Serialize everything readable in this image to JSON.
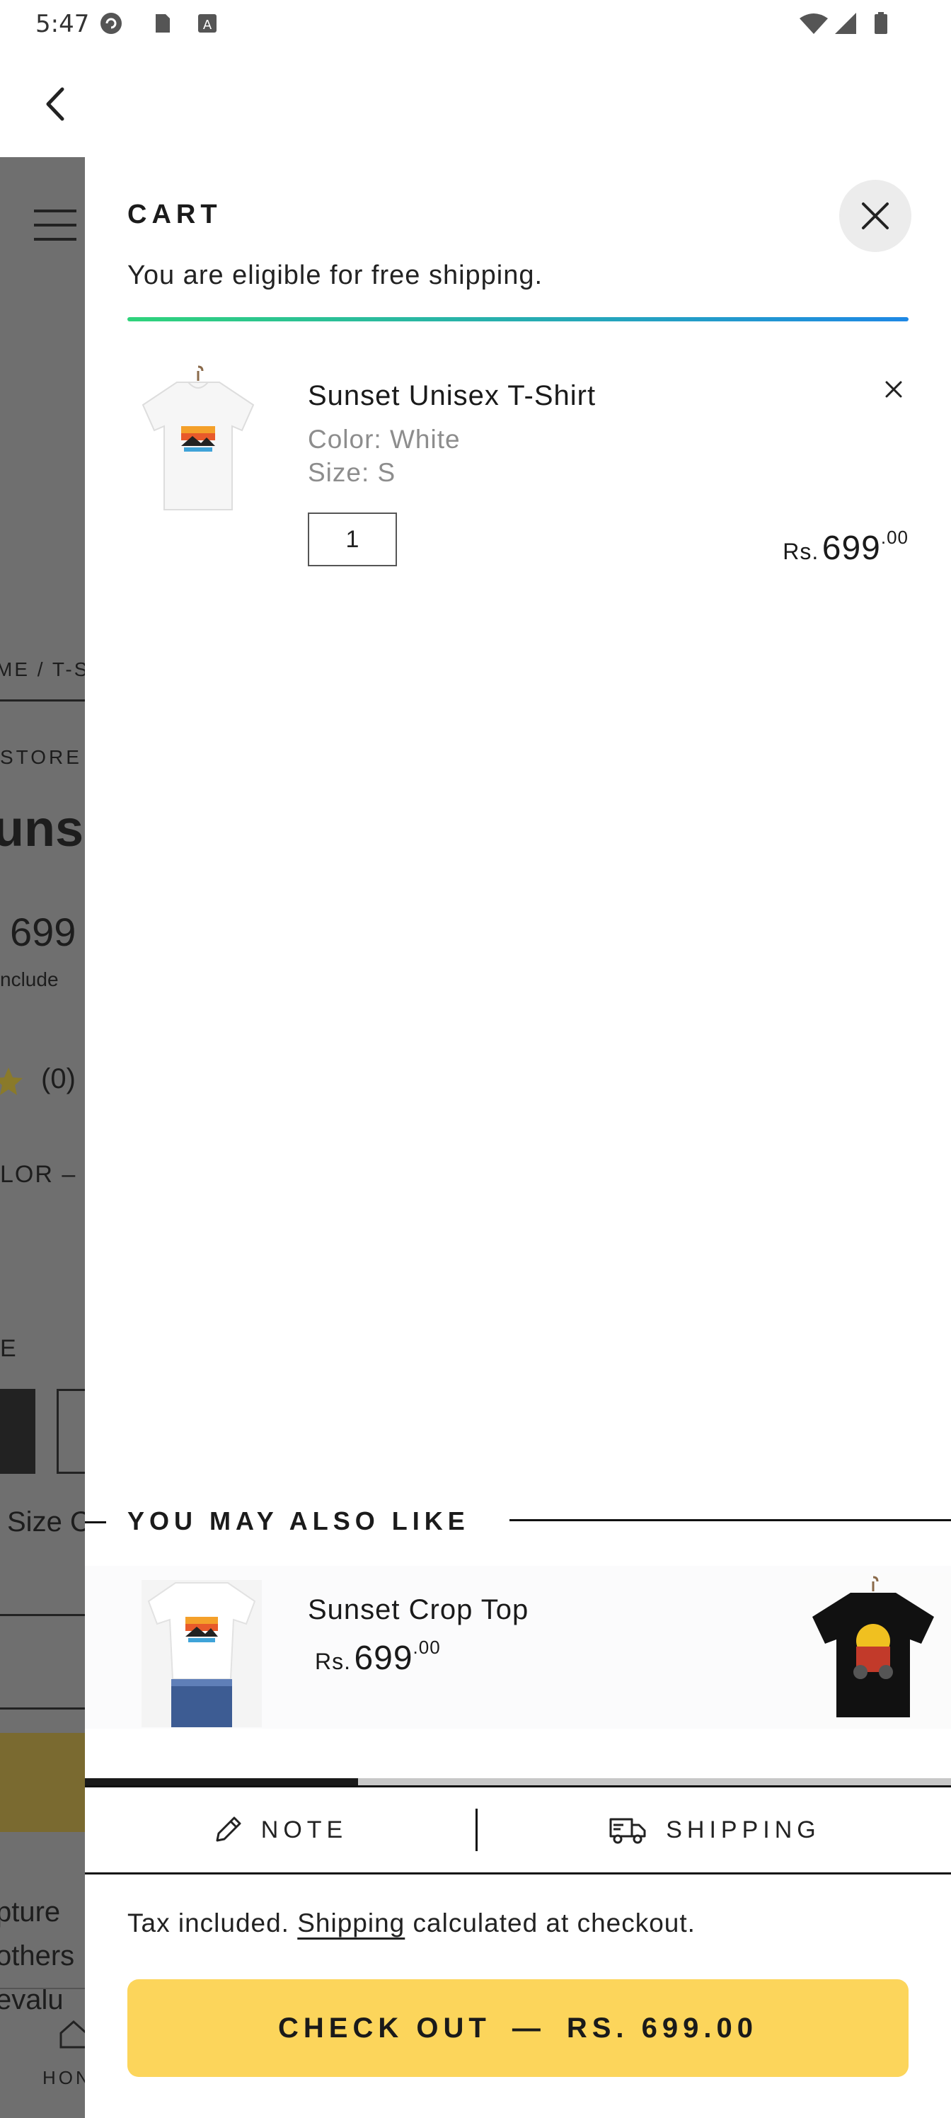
{
  "status_bar": {
    "time": "5:47"
  },
  "background_page": {
    "breadcrumb_fragment": "ME / T-S",
    "store_fragment": "STORE",
    "title_fragment": "unse",
    "price_fragment": "699",
    "tax_fragment": "nclude",
    "rating_fragment": "(0)",
    "color_fragment": "LOR –",
    "size_fragment": "E",
    "size_chart_fragment": "Size C",
    "nav_home_fragment": "HON",
    "description_lines": [
      "pture",
      "others",
      "evalu"
    ]
  },
  "cart": {
    "title": "CART",
    "shipping_message": "You are eligible for free shipping.",
    "progress_fraction": 1.0,
    "items": [
      {
        "name": "Sunset Unisex T-Shirt",
        "color": "Color: White",
        "size": "Size: S",
        "quantity": "1",
        "price_currency": "Rs.",
        "price_whole": "699",
        "price_cents": ".00"
      }
    ]
  },
  "recommendations": {
    "title": "YOU MAY ALSO LIKE",
    "items": [
      {
        "name": "Sunset Crop Top",
        "price_currency": "Rs.",
        "price_whole": "699",
        "price_cents": ".00"
      }
    ]
  },
  "tabs": {
    "note_label": "NOTE",
    "shipping_label": "SHIPPING"
  },
  "footer": {
    "tax_text_before": "Tax included.",
    "tax_link": "Shipping",
    "tax_text_after": "calculated at checkout.",
    "checkout_label": "CHECK OUT",
    "checkout_separator": "—",
    "checkout_total": "RS. 699.00"
  },
  "colors": {
    "accent_checkout": "#fcd55b",
    "progress_start": "#2fd37b",
    "progress_end": "#1e88e5",
    "overlay": "#6f6f6f"
  },
  "icons": [
    "back-arrow-icon",
    "close-icon",
    "remove-icon",
    "pencil-icon",
    "truck-icon",
    "star-icon",
    "home-icon",
    "hamburger-icon"
  ]
}
